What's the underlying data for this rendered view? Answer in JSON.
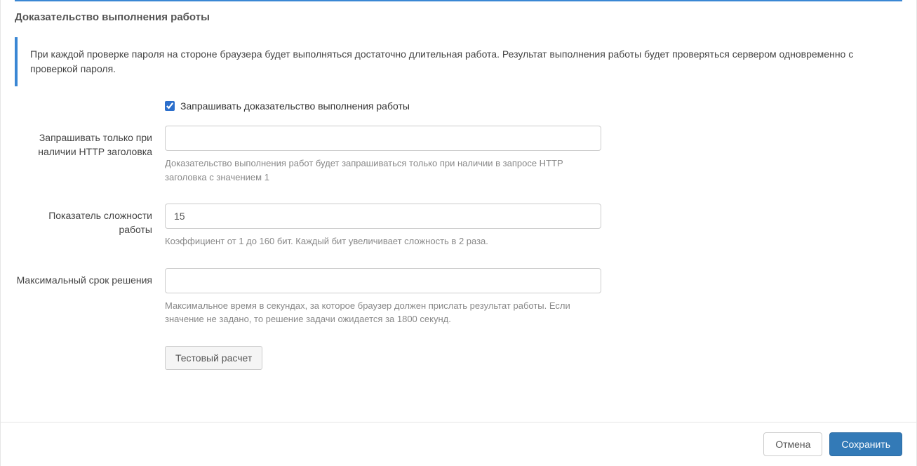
{
  "section": {
    "title": "Доказательство выполнения работы",
    "info": "При каждой проверке пароля на стороне браузера будет выполняться достаточно длительная работа. Результат выполнения работы будет проверяться сервером одновременно с проверкой пароля."
  },
  "fields": {
    "enable": {
      "label": "Запрашивать доказательство выполнения работы",
      "checked": true
    },
    "http_header": {
      "label": "Запрашивать только при наличии HTTP заголовка",
      "value": "",
      "help": "Доказательство выполнения работ будет запрашиваться только при наличии в запросе HTTP заголовка с значением 1"
    },
    "difficulty": {
      "label": "Показатель сложности работы",
      "value": "15",
      "help": "Коэффициент от 1 до 160 бит. Каждый бит увеличивает сложность в 2 раза."
    },
    "max_time": {
      "label": "Максимальный срок решения",
      "value": "",
      "help": "Максимальное время в секундах, за которое браузер должен прислать результат работы. Если значение не задано, то решение задачи ожидается за 1800 секунд."
    },
    "test_button": "Тестовый расчет"
  },
  "footer": {
    "cancel": "Отмена",
    "save": "Сохранить"
  }
}
